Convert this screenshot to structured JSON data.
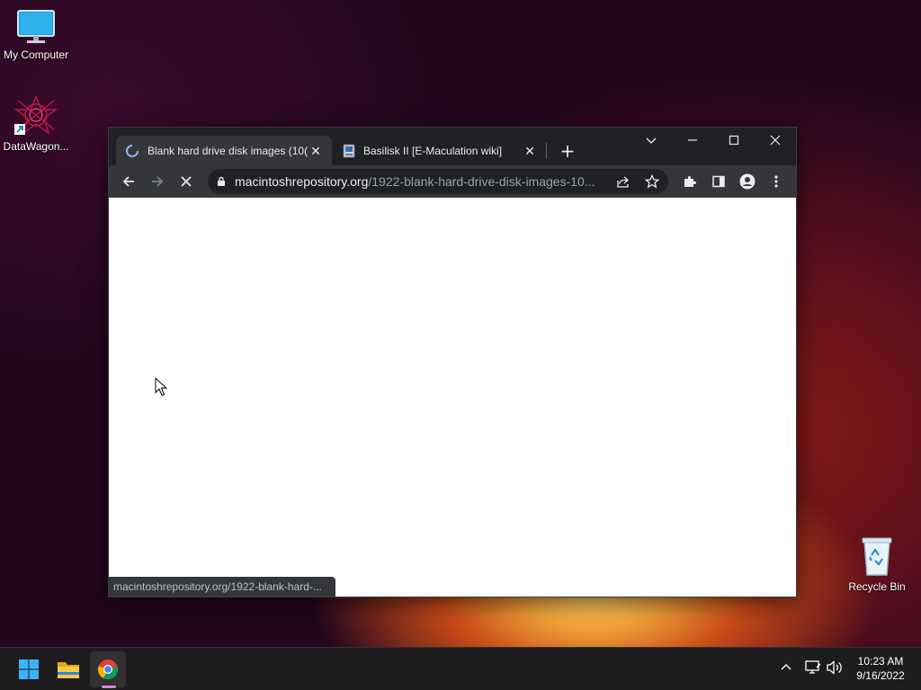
{
  "desktop": {
    "icons": [
      {
        "label": "My Computer",
        "icon": "monitor-icon"
      },
      {
        "label": "DataWagon...",
        "icon": "datawagon-icon"
      },
      {
        "label": "Recycle Bin",
        "icon": "recycle-bin-icon"
      }
    ]
  },
  "browser": {
    "tabs": [
      {
        "title": "Blank hard drive disk images (10(",
        "icon": "loading-spinner-icon",
        "active": true
      },
      {
        "title": "Basilisk II [E-Maculation wiki]",
        "icon": "favicon-icon",
        "active": false
      }
    ],
    "close_glyph": "✕",
    "new_tab_glyph": "+",
    "address": {
      "host": "macintoshrepository.org",
      "path": "/1922-blank-hard-drive-disk-images-10..."
    },
    "status_url": "macintoshrepository.org/1922-blank-hard-...",
    "colors": {
      "frame": "#202124",
      "toolbar": "#35363a",
      "text": "#e8eaed"
    }
  },
  "taskbar": {
    "apps": [
      "start-icon",
      "file-explorer-icon",
      "chrome-icon"
    ],
    "clock": {
      "time": "10:23 AM",
      "date": "9/16/2022"
    }
  }
}
